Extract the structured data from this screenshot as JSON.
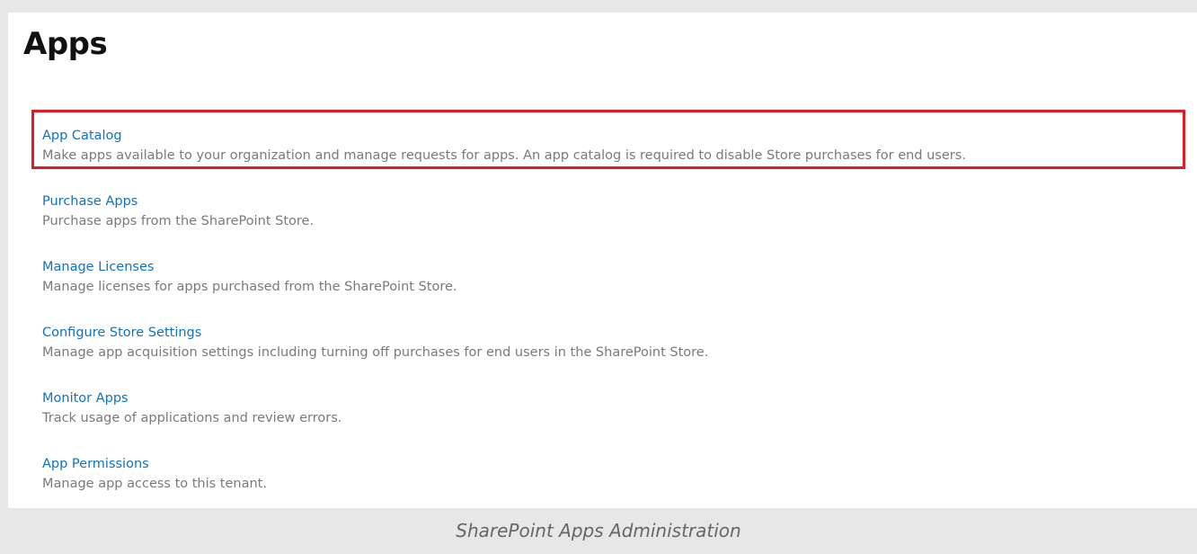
{
  "page": {
    "title": "Apps"
  },
  "apps": [
    {
      "label": "App Catalog",
      "description": "Make apps available to your organization and manage requests for apps. An app catalog is required to disable Store purchases for end users."
    },
    {
      "label": "Purchase Apps",
      "description": "Purchase apps from the SharePoint Store."
    },
    {
      "label": "Manage Licenses",
      "description": "Manage licenses for apps purchased from the SharePoint Store."
    },
    {
      "label": "Configure Store Settings",
      "description": "Manage app acquisition settings including turning off purchases for end users in the SharePoint Store."
    },
    {
      "label": "Monitor Apps",
      "description": "Track usage of applications and review errors."
    },
    {
      "label": "App Permissions",
      "description": "Manage app access to this tenant."
    }
  ],
  "highlight": {
    "target": "App Catalog",
    "color": "#e01b24"
  },
  "colors": {
    "link": "#0f72c4",
    "description": "#7a7a7a",
    "caption_band": "#e7e7e7"
  },
  "caption": "SharePoint Apps Administration"
}
